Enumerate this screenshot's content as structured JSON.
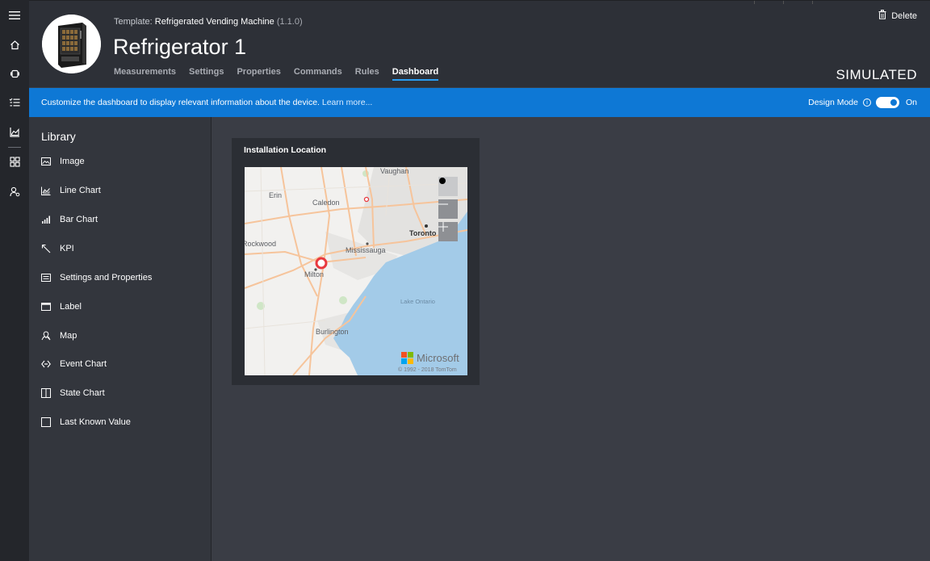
{
  "header": {
    "template_prefix": "Template:",
    "template_name": "Refrigerated Vending Machine",
    "template_version": "(1.1.0)",
    "device_name": "Refrigerator 1",
    "tabs": [
      {
        "label": "Measurements"
      },
      {
        "label": "Settings"
      },
      {
        "label": "Properties"
      },
      {
        "label": "Commands"
      },
      {
        "label": "Rules"
      },
      {
        "label": "Dashboard",
        "active": true
      }
    ],
    "delete_label": "Delete",
    "status": "SIMULATED"
  },
  "infobar": {
    "message": "Customize the dashboard to display relevant information about the device.",
    "learn_more": "Learn more...",
    "design_mode_label": "Design Mode",
    "toggle_state": "On",
    "color": "#0e78d5"
  },
  "library": {
    "title": "Library",
    "items": [
      {
        "label": "Image",
        "icon": "image-icon"
      },
      {
        "label": "Line Chart",
        "icon": "line-chart-icon"
      },
      {
        "label": "Bar Chart",
        "icon": "bar-chart-icon"
      },
      {
        "label": "KPI",
        "icon": "kpi-icon"
      },
      {
        "label": "Settings and Properties",
        "icon": "settings-properties-icon"
      },
      {
        "label": "Label",
        "icon": "label-icon"
      },
      {
        "label": "Map",
        "icon": "map-icon"
      },
      {
        "label": "Event Chart",
        "icon": "event-chart-icon"
      },
      {
        "label": "State Chart",
        "icon": "state-chart-icon"
      },
      {
        "label": "Last Known Value",
        "icon": "last-known-value-icon"
      }
    ]
  },
  "tile": {
    "title": "Installation Location",
    "map": {
      "places": [
        "Vaughan",
        "Erin",
        "Caledon",
        "Rockwood",
        "Toronto",
        "Mississauga",
        "Milton",
        "Lake Ontario",
        "Burlington"
      ],
      "brand": "Microsoft",
      "copyright": "© 1992 - 2018 TomTom"
    }
  },
  "nav_rail": {
    "icons": [
      "menu-icon",
      "home-icon",
      "devices-icon",
      "rules-list-icon",
      "analytics-icon",
      "dashboard-grid-icon",
      "administration-icon"
    ]
  }
}
